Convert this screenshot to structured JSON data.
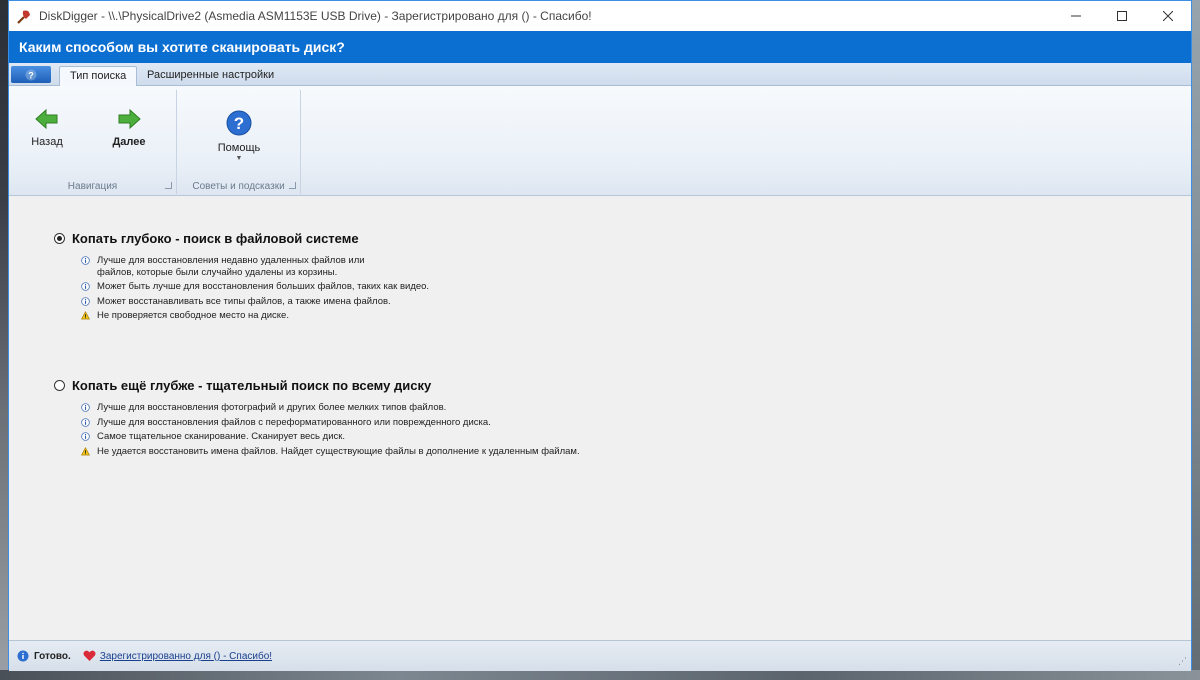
{
  "window": {
    "title": "DiskDigger - \\\\.\\PhysicalDrive2 (Asmedia ASM1153E USB Drive) - Зарегистрировано для  () - Спасибо!",
    "app_icon": "shovel-icon",
    "controls": [
      "minimize-icon",
      "maximize-icon",
      "close-icon"
    ]
  },
  "header": {
    "title": "Каким способом вы хотите сканировать диск?"
  },
  "tabs": {
    "app_button_icon": "help-icon",
    "items": [
      {
        "label": "Тип поиска",
        "active": true
      },
      {
        "label": "Расширенные настройки",
        "active": false
      }
    ]
  },
  "ribbon": {
    "groups": [
      {
        "label": "Навигация",
        "buttons": [
          {
            "label": "Назад",
            "icon": "arrow-left-icon"
          },
          {
            "label": "Далее",
            "icon": "arrow-right-icon"
          }
        ]
      },
      {
        "label": "Советы и подсказки",
        "buttons": [
          {
            "label": "Помощь",
            "icon": "help-icon"
          }
        ]
      }
    ]
  },
  "options": [
    {
      "title": "Копать глубоко - поиск в файловой системе",
      "selected": true,
      "bullets": [
        {
          "icon": "info-icon",
          "lines": [
            "Лучше для восстановления недавно удаленных файлов или",
            "файлов, которые были случайно удалены из корзины."
          ]
        },
        {
          "icon": "info-icon",
          "lines": [
            "Может быть лучше для восстановления больших файлов, таких как видео."
          ]
        },
        {
          "icon": "info-icon",
          "lines": [
            "Может восстанавливать все типы файлов, а также имена файлов."
          ]
        },
        {
          "icon": "warning-icon",
          "lines": [
            "Не проверяется свободное место на диске."
          ]
        }
      ]
    },
    {
      "title": "Копать ещё глубже - тщательный поиск по всему диску",
      "selected": false,
      "bullets": [
        {
          "icon": "info-icon",
          "lines": [
            "Лучше для восстановления фотографий и других более мелких типов файлов."
          ]
        },
        {
          "icon": "info-icon",
          "lines": [
            "Лучше для восстановления файлов с переформатированного или поврежденного диска."
          ]
        },
        {
          "icon": "info-icon",
          "lines": [
            "Самое тщательное сканирование. Сканирует весь диск."
          ]
        },
        {
          "icon": "warning-icon",
          "lines": [
            "Не удается восстановить имена файлов. Найдет существующие файлы в дополнение к удаленным файлам."
          ]
        }
      ]
    }
  ],
  "status": {
    "ready": "Готово.",
    "link": "Зарегистрированно для  () - Спасибо!"
  },
  "colors": {
    "header_bg": "#0b6fd2",
    "accent_green": "#3fa33a"
  }
}
